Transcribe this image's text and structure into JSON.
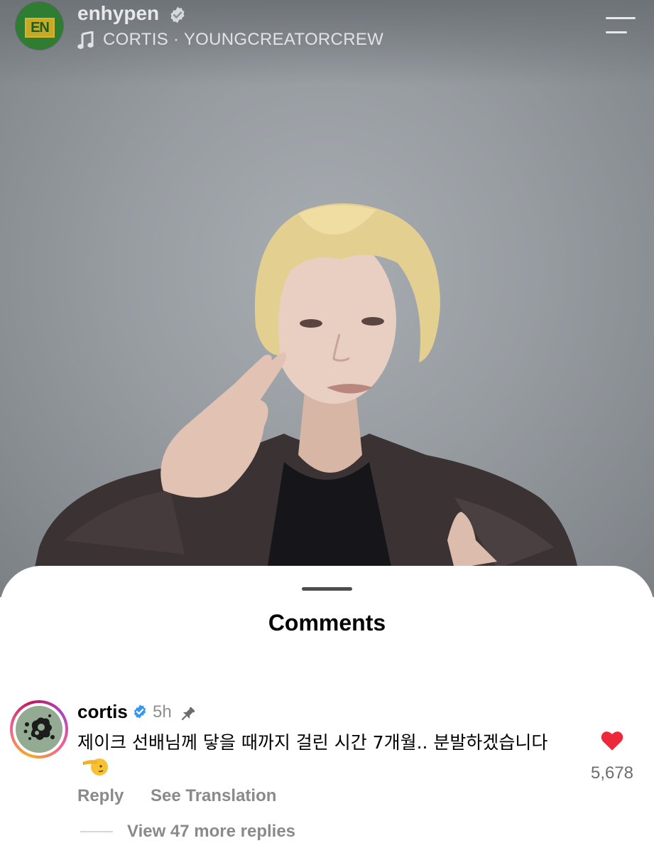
{
  "post": {
    "account_name": "enhypen",
    "avatar_text": "EN",
    "audio_label": "CORTIS · YOUNGCREATORCREW"
  },
  "comments_sheet": {
    "title": "Comments",
    "comments": [
      {
        "username": "cortis",
        "verified": true,
        "time": "5h",
        "pinned": true,
        "text": "제이크 선배님께 닿을 때까지 걸린 시간 7개월.. 분발하겠습니다",
        "emoji": "salute",
        "like_count": "5,678",
        "liked": true,
        "reply_label": "Reply",
        "translate_label": "See Translation",
        "view_replies_label": "View 47 more replies"
      }
    ]
  },
  "colors": {
    "like_red": "#ed2939",
    "verified_blue": "#3797f0",
    "secondary_text": "#8a8a8a"
  },
  "icons": [
    "verified-badge-icon",
    "music-note-icon",
    "menu-icon",
    "pin-icon",
    "heart-icon",
    "salute-emoji-icon"
  ]
}
